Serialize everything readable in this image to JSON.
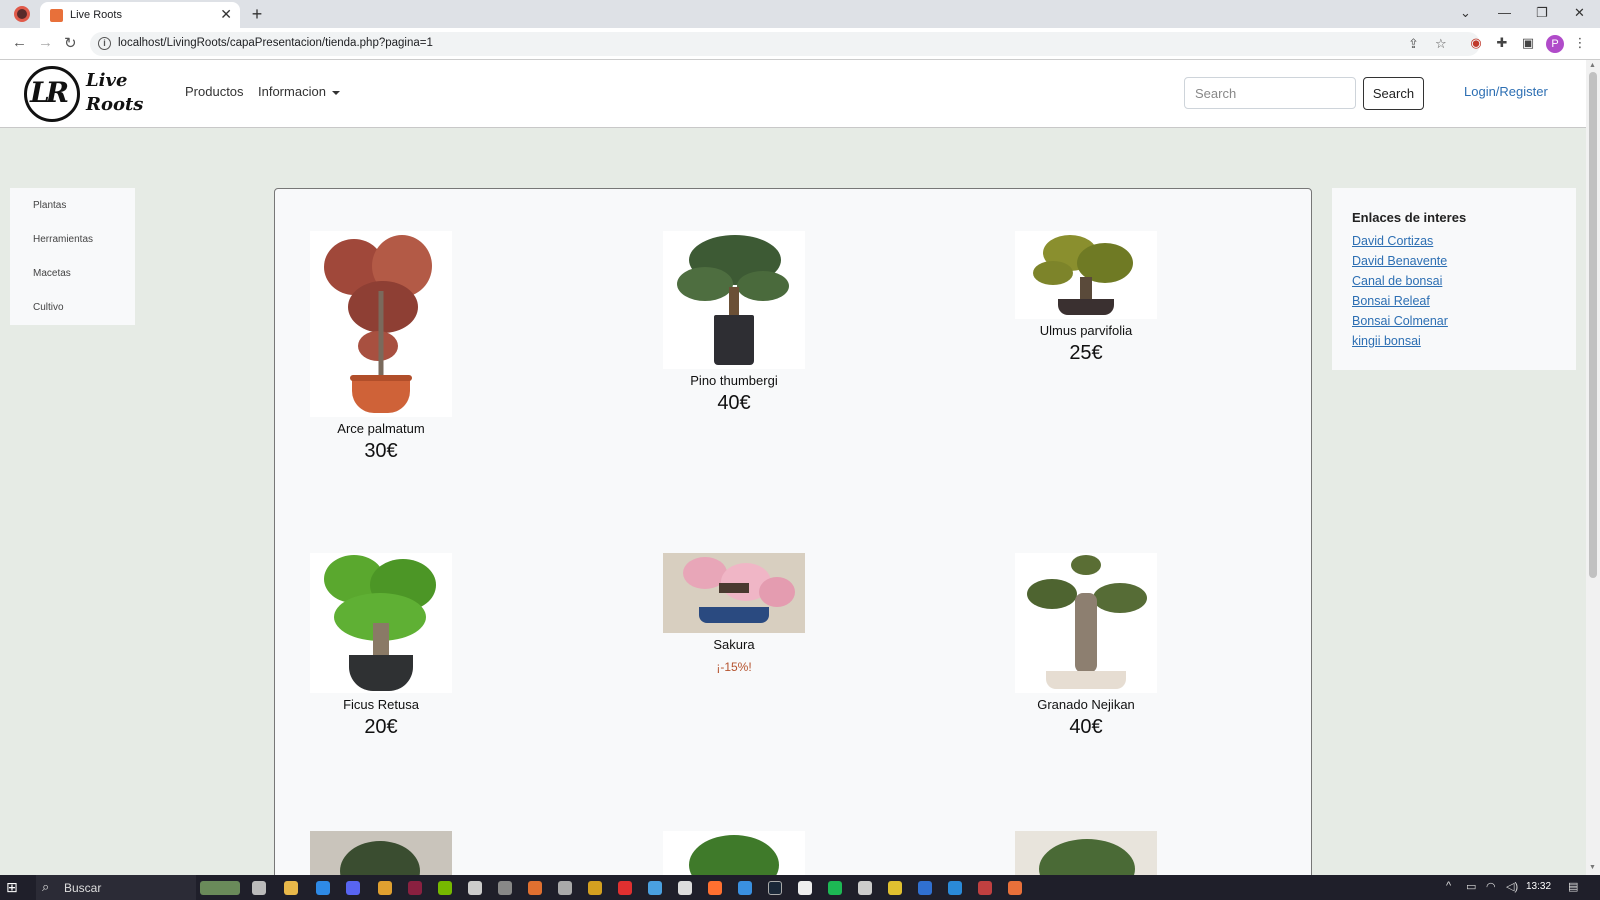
{
  "browser": {
    "tab_title": "Live Roots",
    "url": "localhost/LivingRoots/capaPresentacion/tienda.php?pagina=1",
    "profile_initial": "P"
  },
  "navbar": {
    "logo_monogram": "LR",
    "logo_line1": "Live",
    "logo_line2": "Roots",
    "links": [
      {
        "label": "Productos"
      },
      {
        "label": "Informacion"
      }
    ],
    "search_placeholder": "Search",
    "search_button": "Search",
    "login": "Login/Register"
  },
  "left_sidebar": {
    "items": [
      {
        "label": "Plantas"
      },
      {
        "label": "Herramientas"
      },
      {
        "label": "Macetas"
      },
      {
        "label": "Cultivo"
      }
    ]
  },
  "products": [
    {
      "name": "Arce palmatum",
      "price": "30€",
      "icon": "red-maple-bonsai"
    },
    {
      "name": "Pino thumbergi",
      "price": "40€",
      "icon": "pine-bonsai"
    },
    {
      "name": "Ulmus parvifolia",
      "price": "25€",
      "icon": "elm-bonsai"
    },
    {
      "name": "Ficus Retusa",
      "price": "20€",
      "icon": "ficus-bonsai"
    },
    {
      "name": "Sakura",
      "promo": "¡-15%!",
      "icon": "cherry-blossom-bonsai"
    },
    {
      "name": "Granado Nejikan",
      "price": "40€",
      "icon": "pomegranate-bonsai"
    }
  ],
  "right_sidebar": {
    "heading": "Enlaces de interes",
    "links": [
      {
        "label": "David Cortizas"
      },
      {
        "label": "David Benavente"
      },
      {
        "label": "Canal de bonsai"
      },
      {
        "label": "Bonsai Releaf"
      },
      {
        "label": "Bonsai Colmenar"
      },
      {
        "label": "kingii bonsai"
      }
    ]
  },
  "taskbar": {
    "search_label": "Buscar",
    "time": "13:32"
  },
  "colors": {
    "page_bg": "#e6ebe5",
    "link": "#2d6fb3",
    "promo": "#b5532e"
  }
}
